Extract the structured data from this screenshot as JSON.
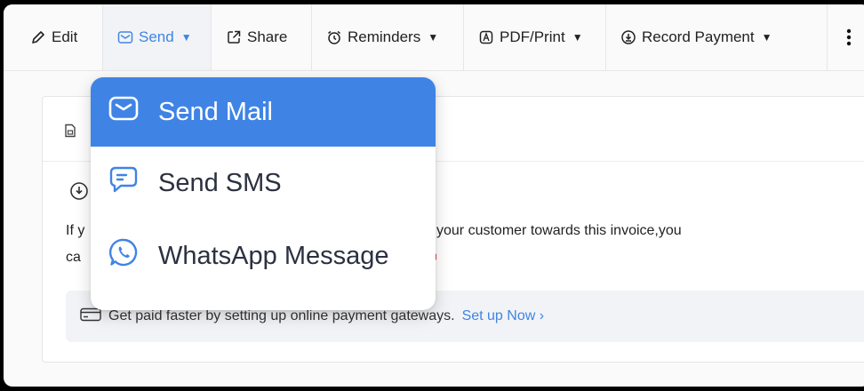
{
  "toolbar": {
    "edit_label": "Edit",
    "send_label": "Send",
    "share_label": "Share",
    "reminders_label": "Reminders",
    "pdf_print_label": "PDF/Print",
    "record_payment_label": "Record Payment"
  },
  "send_menu": {
    "items": [
      {
        "label": "Send Mail",
        "icon": "mail-icon"
      },
      {
        "label": "Send SMS",
        "icon": "sms-icon"
      },
      {
        "label": "WhatsApp Message",
        "icon": "whatsapp-icon"
      }
    ],
    "selected_index": 0
  },
  "content": {
    "line1_left": "If y",
    "line1_right": "your customer towards this invoice,you",
    "line2_left": "ca"
  },
  "banner": {
    "text": "Get paid faster by setting up online payment gateways.",
    "link": "Set up Now ›"
  },
  "colors": {
    "accent": "#3f84e5",
    "background": "#fafafa"
  }
}
